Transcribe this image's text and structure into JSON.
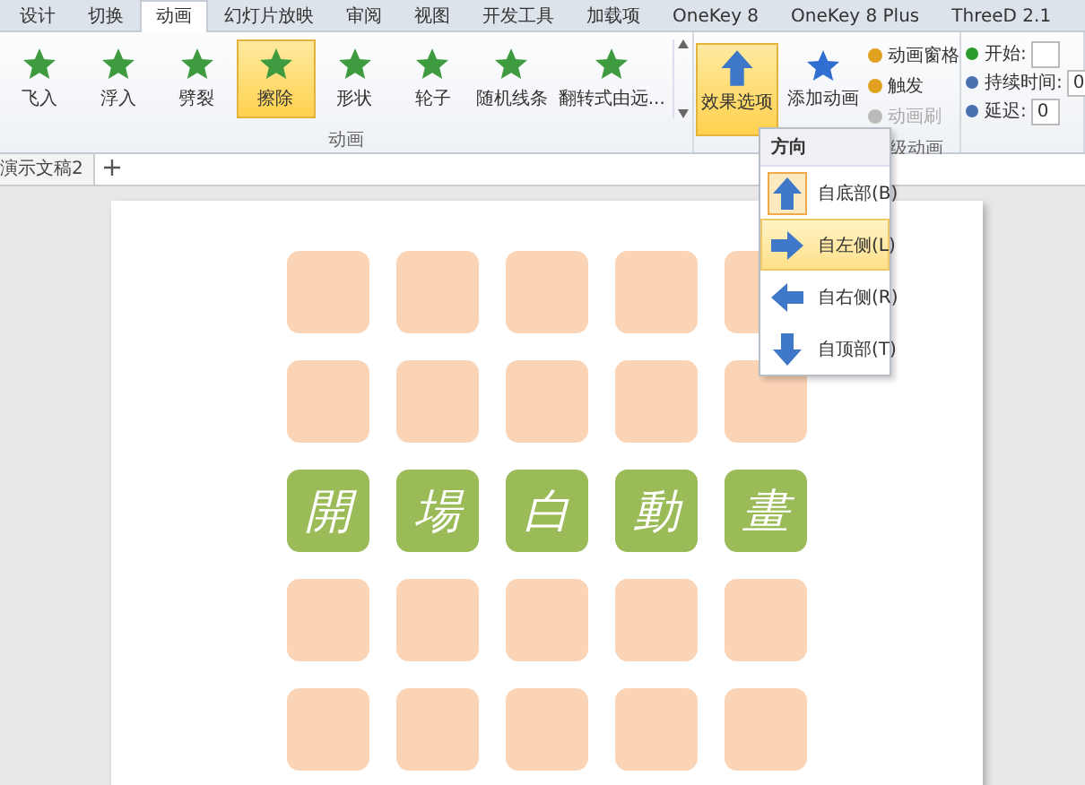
{
  "ribbon_tabs": [
    {
      "label": "设计",
      "selected": false
    },
    {
      "label": "切换",
      "selected": false
    },
    {
      "label": "动画",
      "selected": true
    },
    {
      "label": "幻灯片放映",
      "selected": false
    },
    {
      "label": "审阅",
      "selected": false
    },
    {
      "label": "视图",
      "selected": false
    },
    {
      "label": "开发工具",
      "selected": false
    },
    {
      "label": "加载项",
      "selected": false
    },
    {
      "label": "OneKey 8",
      "selected": false
    },
    {
      "label": "OneKey 8 Plus",
      "selected": false
    },
    {
      "label": "ThreeD 2.1",
      "selected": false
    }
  ],
  "animations": [
    {
      "label": "飞入",
      "selected": false
    },
    {
      "label": "浮入",
      "selected": false
    },
    {
      "label": "劈裂",
      "selected": false
    },
    {
      "label": "擦除",
      "selected": true
    },
    {
      "label": "形状",
      "selected": false
    },
    {
      "label": "轮子",
      "selected": false
    },
    {
      "label": "随机线条",
      "selected": false
    },
    {
      "label": "翻转式由远...",
      "selected": false
    }
  ],
  "animations_group_label": "动画",
  "effect_options": {
    "label": "效果选项",
    "expanded": true
  },
  "add_animation": {
    "label": "添加动画"
  },
  "advanced_items": [
    {
      "label": "动画窗格",
      "disabled": false
    },
    {
      "label": "触发",
      "disabled": false
    },
    {
      "label": "动画刷",
      "disabled": true
    }
  ],
  "advanced_group_label": "级动画",
  "timing": [
    {
      "label": "开始:"
    },
    {
      "label": "持续时间:",
      "value": "0"
    },
    {
      "label": "延迟:",
      "value": "0"
    }
  ],
  "dropdown": {
    "heading": "方向",
    "items": [
      {
        "label": "自底部(B)",
        "kind": "up",
        "selected": true,
        "hovered": false
      },
      {
        "label": "自左侧(L)",
        "kind": "right",
        "selected": false,
        "hovered": true
      },
      {
        "label": "自右侧(R)",
        "kind": "left",
        "selected": false,
        "hovered": false
      },
      {
        "label": "自顶部(T)",
        "kind": "down",
        "selected": false,
        "hovered": false
      }
    ]
  },
  "document_tab": "演示文稿2",
  "tile_rows": [
    {
      "tiles": [
        {
          "kind": "blank"
        },
        {
          "kind": "blank"
        },
        {
          "kind": "blank"
        },
        {
          "kind": "blank"
        },
        {
          "kind": "blank"
        }
      ]
    },
    {
      "tiles": [
        {
          "kind": "blank"
        },
        {
          "kind": "blank"
        },
        {
          "kind": "blank"
        },
        {
          "kind": "blank"
        },
        {
          "kind": "blank"
        }
      ]
    },
    {
      "tiles": [
        {
          "kind": "glyph",
          "char": "開"
        },
        {
          "kind": "glyph",
          "char": "場"
        },
        {
          "kind": "glyph",
          "char": "白"
        },
        {
          "kind": "glyph",
          "char": "動"
        },
        {
          "kind": "glyph",
          "char": "畫"
        }
      ]
    },
    {
      "tiles": [
        {
          "kind": "blank"
        },
        {
          "kind": "blank"
        },
        {
          "kind": "blank"
        },
        {
          "kind": "blank"
        },
        {
          "kind": "blank"
        }
      ]
    },
    {
      "tiles": [
        {
          "kind": "blank"
        },
        {
          "kind": "blank"
        },
        {
          "kind": "blank"
        },
        {
          "kind": "blank"
        },
        {
          "kind": "blank"
        }
      ]
    }
  ]
}
